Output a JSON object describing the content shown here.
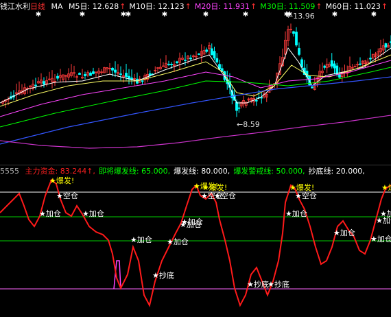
{
  "header": {
    "stock_name": "钱江水利",
    "period": "日线",
    "ma_label": "MA",
    "ma": [
      {
        "label": "M5日:",
        "value": "12.628",
        "color": "#ffffff"
      },
      {
        "label": "M10日:",
        "value": "12.123",
        "color": "#ffffff"
      },
      {
        "label": "M20日:",
        "value": "11.931",
        "color": "#ff44ff"
      },
      {
        "label": "M30日:",
        "value": "11.509",
        "color": "#00ff00"
      },
      {
        "label": "M60日:",
        "value": "11.023",
        "color": "#ffffff"
      }
    ],
    "up_arrow": "↑"
  },
  "price_chart": {
    "high_label": "13.96",
    "low_label": "8.59",
    "arrow": "←"
  },
  "indicator": {
    "code": "5555",
    "items": [
      {
        "label": "主力资金:",
        "value": "83.244",
        "color": "#ff2020",
        "arrow": "↑"
      },
      {
        "label": "即将爆发线:",
        "value": "65.000",
        "color": "#00ff00"
      },
      {
        "label": "爆发线:",
        "value": "80.000",
        "color": "#ffffff"
      },
      {
        "label": "爆发警戒线:",
        "value": "50.000",
        "color": "#00ff00"
      },
      {
        "label": "抄底线:",
        "value": "20.000",
        "color": "#ffffff"
      }
    ],
    "star": "★",
    "signals": [
      {
        "text": "爆发!",
        "hot": true
      },
      {
        "text": "空仓",
        "hot": false
      },
      {
        "text": "加仓",
        "hot": false
      },
      {
        "text": "加仓",
        "hot": false
      },
      {
        "text": "加仓",
        "hot": false
      },
      {
        "text": "抄底",
        "hot": false
      },
      {
        "text": "爆发!",
        "hot": true
      },
      {
        "text": "爆发!",
        "hot": true
      },
      {
        "text": "空仓",
        "hot": false
      },
      {
        "text": "空仓",
        "hot": false
      },
      {
        "text": "加仓",
        "hot": false
      },
      {
        "text": "加仓",
        "hot": false
      },
      {
        "text": "加仓",
        "hot": false
      },
      {
        "text": "抄底",
        "hot": false
      },
      {
        "text": "抄底",
        "hot": false
      },
      {
        "text": "爆发!",
        "hot": true
      },
      {
        "text": "空仓",
        "hot": false
      },
      {
        "text": "加仓",
        "hot": false
      },
      {
        "text": "加仓",
        "hot": false
      },
      {
        "text": "加仓",
        "hot": false
      },
      {
        "text": "加仓",
        "hot": false
      },
      {
        "text": "加仓",
        "hot": false
      },
      {
        "text": "爆发!",
        "hot": true
      }
    ]
  }
}
